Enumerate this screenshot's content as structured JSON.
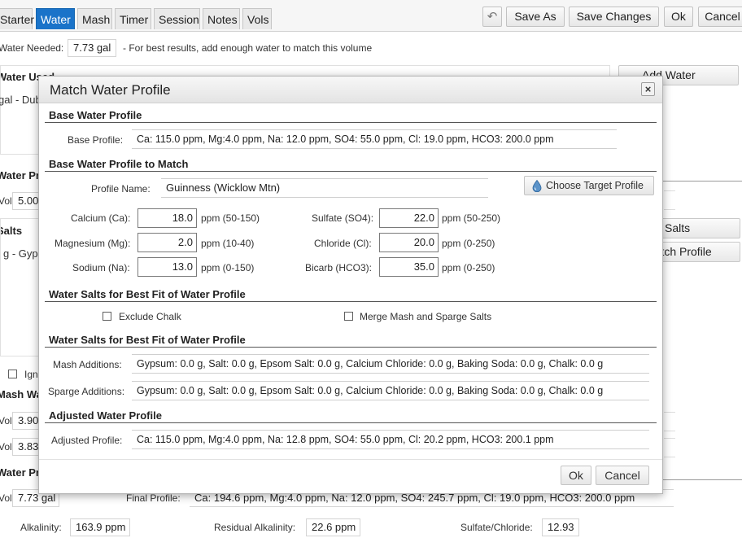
{
  "tabs": [
    {
      "label": "Starter"
    },
    {
      "label": "Water"
    },
    {
      "label": "Mash"
    },
    {
      "label": "Timer"
    },
    {
      "label": "Session"
    },
    {
      "label": "Notes"
    },
    {
      "label": "Vols"
    }
  ],
  "toolbar": {
    "save_as": "Save As",
    "save_changes": "Save Changes",
    "ok": "Ok",
    "cancel": "Cancel"
  },
  "background": {
    "water_needed_label": "Water Needed:",
    "water_needed_value": "7.73 gal",
    "water_needed_note": "- For best results, add enough water to match this volume",
    "water_used_heading": "Water Used",
    "water_used_row": "gal - Dublin",
    "add_water": "Add Water",
    "water_profile_heading": "Water Profile",
    "profile_vol_label": "Vol:",
    "profile_vol_value": "5.00",
    "salts_heading": "Salts",
    "salts_row": "g - Gypsum",
    "salts_button": "Salts",
    "match_profile_button": "Match Profile",
    "ignore_label": "Ignore",
    "mash_heading": "Mash Water",
    "mash_vol_label": "Vol:",
    "mash_vol_value": "3.90",
    "sparge_vol_label": "Vol:",
    "sparge_vol_value": "3.83",
    "final_heading": "Water Profile",
    "final_vol_label": "Vol:",
    "final_vol_value": "7.73 gal",
    "final_profile_label": "Final Profile:",
    "final_profile_value": "Ca: 194.6 ppm, Mg:4.0 ppm, Na: 12.0 ppm, SO4: 245.7 ppm, Cl: 19.0 ppm, HCO3: 200.0 ppm",
    "alkalinity_label": "Alkalinity:",
    "alkalinity_value": "163.9 ppm",
    "residual_label": "Residual Alkalinity:",
    "residual_value": "22.6 ppm",
    "sulfate_chloride_label": "Sulfate/Chloride:",
    "sulfate_chloride_value": "12.93"
  },
  "modal": {
    "title": "Match Water Profile",
    "close": "×",
    "base_section": "Base Water Profile",
    "base_profile_label": "Base Profile:",
    "base_profile_value": "Ca: 115.0 ppm, Mg:4.0 ppm, Na: 12.0 ppm, SO4: 55.0 ppm, Cl: 19.0 ppm, HCO3: 200.0 ppm",
    "match_section": "Base Water Profile to Match",
    "profile_name_label": "Profile Name:",
    "profile_name_value": "Guinness (Wicklow Mtn)",
    "choose_target": "Choose Target Profile",
    "ions": {
      "calcium": {
        "label": "Calcium (Ca):",
        "value": "18.0",
        "range": "ppm (50-150)"
      },
      "magnesium": {
        "label": "Magnesium (Mg):",
        "value": "2.0",
        "range": "ppm (10-40)"
      },
      "sodium": {
        "label": "Sodium (Na):",
        "value": "13.0",
        "range": "ppm (0-150)"
      },
      "sulfate": {
        "label": "Sulfate (SO4):",
        "value": "22.0",
        "range": "ppm (50-250)"
      },
      "chloride": {
        "label": "Chloride (Cl):",
        "value": "20.0",
        "range": "ppm (0-250)"
      },
      "bicarb": {
        "label": "Bicarb (HCO3):",
        "value": "35.0",
        "range": "ppm (0-250)"
      }
    },
    "salts_section_1": "Water Salts for Best Fit of Water Profile",
    "exclude_chalk": "Exclude Chalk",
    "merge_salts": "Merge Mash and Sparge Salts",
    "salts_section_2": "Water Salts for Best Fit of Water Profile",
    "mash_additions_label": "Mash Additions:",
    "mash_additions_value": "Gypsum: 0.0 g, Salt: 0.0 g, Epsom Salt: 0.0 g, Calcium Chloride: 0.0 g, Baking Soda: 0.0 g, Chalk: 0.0 g",
    "sparge_additions_label": "Sparge Additions:",
    "sparge_additions_value": "Gypsum: 0.0 g, Salt: 0.0 g, Epsom Salt: 0.0 g, Calcium Chloride: 0.0 g, Baking Soda: 0.0 g, Chalk: 0.0 g",
    "adjusted_section": "Adjusted Water Profile",
    "adjusted_profile_label": "Adjusted Profile:",
    "adjusted_profile_value": "Ca: 115.0 ppm, Mg:4.0 ppm, Na: 12.8 ppm, SO4: 55.0 ppm, Cl: 20.2 ppm, HCO3: 200.1 ppm",
    "ok": "Ok",
    "cancel": "Cancel"
  }
}
